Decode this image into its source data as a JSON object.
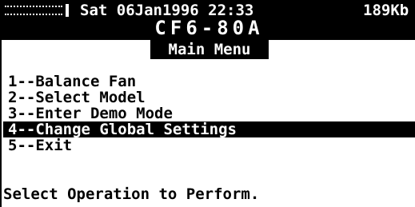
{
  "status_bar": {
    "battery_icon": "battery-icon",
    "datetime": "Sat 06Jan1996 22:33",
    "memory": "189Kb"
  },
  "model_title": "CF6-80A",
  "menu": {
    "title": "Main Menu",
    "items": [
      {
        "label": "1--Balance Fan",
        "selected": false
      },
      {
        "label": "2--Select Model",
        "selected": false
      },
      {
        "label": "3--Enter Demo Mode",
        "selected": false
      },
      {
        "label": "4--Change Global Settings",
        "selected": true
      },
      {
        "label": "5--Exit",
        "selected": false
      }
    ]
  },
  "prompt": "Select Operation to Perform.",
  "colors": {
    "foreground": "#000000",
    "background": "#ffffff"
  }
}
